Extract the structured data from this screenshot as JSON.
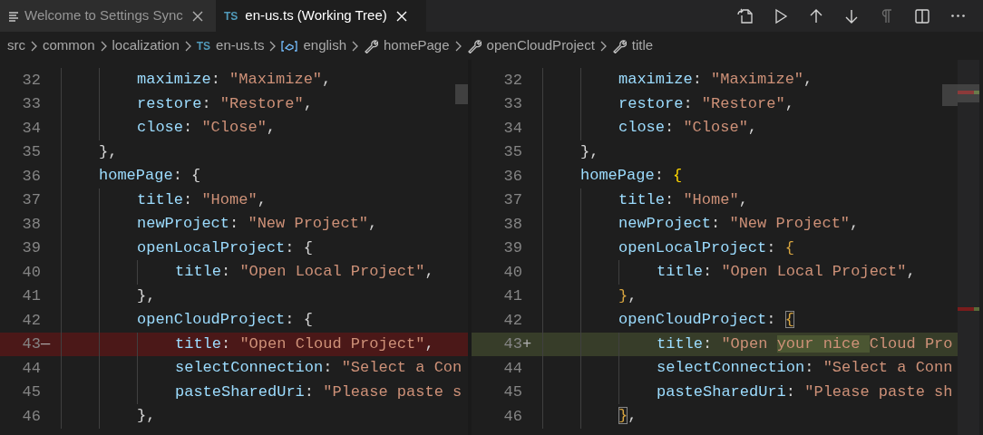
{
  "tabs": [
    {
      "label": "Welcome to Settings Sync",
      "kind": "document",
      "selected": false
    },
    {
      "label": "en-us.ts (Working Tree)",
      "kind": "typescript",
      "badge": "TS",
      "selected": true
    }
  ],
  "toolbar": [
    {
      "kind": "open-file",
      "disabled": false
    },
    {
      "kind": "run",
      "disabled": false
    },
    {
      "kind": "up",
      "disabled": false
    },
    {
      "kind": "down",
      "disabled": false
    },
    {
      "kind": "pilcrow",
      "disabled": true
    },
    {
      "kind": "split",
      "disabled": false
    },
    {
      "kind": "more",
      "disabled": false
    }
  ],
  "breadcrumb": [
    {
      "label": "src",
      "kind": "folder"
    },
    {
      "label": "common",
      "kind": "folder"
    },
    {
      "label": "localization",
      "kind": "folder"
    },
    {
      "label": "en-us.ts",
      "kind": "file",
      "badge": "TS"
    },
    {
      "label": "english",
      "kind": "variable"
    },
    {
      "label": "homePage",
      "kind": "property"
    },
    {
      "label": "openCloudProject",
      "kind": "property"
    },
    {
      "label": "title",
      "kind": "property"
    }
  ],
  "panes": [
    {
      "lines": [
        {
          "number": "32",
          "kind": "context",
          "tokens": [
            {
              "kind": "key",
              "text": "        maximize"
            },
            {
              "kind": "punct",
              "text": ": "
            },
            {
              "kind": "string",
              "text": "\"Maximize\""
            },
            {
              "kind": "punct",
              "text": ","
            }
          ]
        },
        {
          "number": "33",
          "kind": "context",
          "tokens": [
            {
              "kind": "key",
              "text": "        restore"
            },
            {
              "kind": "punct",
              "text": ": "
            },
            {
              "kind": "string",
              "text": "\"Restore\""
            },
            {
              "kind": "punct",
              "text": ","
            }
          ]
        },
        {
          "number": "34",
          "kind": "context",
          "tokens": [
            {
              "kind": "key",
              "text": "        close"
            },
            {
              "kind": "punct",
              "text": ": "
            },
            {
              "kind": "string",
              "text": "\"Close\""
            },
            {
              "kind": "punct",
              "text": ","
            }
          ]
        },
        {
          "number": "35",
          "kind": "context",
          "tokens": [
            {
              "kind": "punct",
              "text": "    },"
            }
          ]
        },
        {
          "number": "36",
          "kind": "context",
          "tokens": [
            {
              "kind": "key",
              "text": "    homePage"
            },
            {
              "kind": "punct",
              "text": ": {"
            }
          ]
        },
        {
          "number": "37",
          "kind": "context",
          "tokens": [
            {
              "kind": "key",
              "text": "        title"
            },
            {
              "kind": "punct",
              "text": ": "
            },
            {
              "kind": "string",
              "text": "\"Home\""
            },
            {
              "kind": "punct",
              "text": ","
            }
          ]
        },
        {
          "number": "38",
          "kind": "context",
          "tokens": [
            {
              "kind": "key",
              "text": "        newProject"
            },
            {
              "kind": "punct",
              "text": ": "
            },
            {
              "kind": "string",
              "text": "\"New Project\""
            },
            {
              "kind": "punct",
              "text": ","
            }
          ]
        },
        {
          "number": "39",
          "kind": "context",
          "tokens": [
            {
              "kind": "key",
              "text": "        openLocalProject"
            },
            {
              "kind": "punct",
              "text": ": {"
            }
          ]
        },
        {
          "number": "40",
          "kind": "context",
          "tokens": [
            {
              "kind": "key",
              "text": "            title"
            },
            {
              "kind": "punct",
              "text": ": "
            },
            {
              "kind": "string",
              "text": "\"Open Local Project\""
            },
            {
              "kind": "punct",
              "text": ","
            }
          ]
        },
        {
          "number": "41",
          "kind": "context",
          "tokens": [
            {
              "kind": "punct",
              "text": "        },"
            }
          ]
        },
        {
          "number": "42",
          "kind": "context",
          "tokens": [
            {
              "kind": "key",
              "text": "        openCloudProject"
            },
            {
              "kind": "punct",
              "text": ": {"
            }
          ]
        },
        {
          "number": "43",
          "marker": "—",
          "kind": "removed",
          "tokens": [
            {
              "kind": "key",
              "text": "            title"
            },
            {
              "kind": "punct",
              "text": ": "
            },
            {
              "kind": "string",
              "text": "\"Open Cloud Project\""
            },
            {
              "kind": "punct",
              "text": ","
            }
          ]
        },
        {
          "number": "44",
          "kind": "context",
          "tokens": [
            {
              "kind": "key",
              "text": "            selectConnection"
            },
            {
              "kind": "punct",
              "text": ": "
            },
            {
              "kind": "string",
              "text": "\"Select a Con"
            }
          ]
        },
        {
          "number": "45",
          "kind": "context",
          "tokens": [
            {
              "kind": "key",
              "text": "            pasteSharedUri"
            },
            {
              "kind": "punct",
              "text": ": "
            },
            {
              "kind": "string",
              "text": "\"Please paste s"
            }
          ]
        },
        {
          "number": "46",
          "kind": "context",
          "tokens": [
            {
              "kind": "punct",
              "text": "        },"
            }
          ]
        }
      ]
    },
    {
      "lines": [
        {
          "number": "32",
          "kind": "context",
          "tokens": [
            {
              "kind": "key",
              "text": "        maximize"
            },
            {
              "kind": "punct",
              "text": ": "
            },
            {
              "kind": "string",
              "text": "\"Maximize\""
            },
            {
              "kind": "punct",
              "text": ","
            }
          ]
        },
        {
          "number": "33",
          "kind": "context",
          "tokens": [
            {
              "kind": "key",
              "text": "        restore"
            },
            {
              "kind": "punct",
              "text": ": "
            },
            {
              "kind": "string",
              "text": "\"Restore\""
            },
            {
              "kind": "punct",
              "text": ","
            }
          ]
        },
        {
          "number": "34",
          "kind": "context",
          "tokens": [
            {
              "kind": "key",
              "text": "        close"
            },
            {
              "kind": "punct",
              "text": ": "
            },
            {
              "kind": "string",
              "text": "\"Close\""
            },
            {
              "kind": "punct",
              "text": ","
            }
          ]
        },
        {
          "number": "35",
          "kind": "context",
          "tokens": [
            {
              "kind": "punct",
              "text": "    },"
            }
          ]
        },
        {
          "number": "36",
          "kind": "context",
          "tokens": [
            {
              "kind": "key",
              "text": "    homePage"
            },
            {
              "kind": "punct",
              "text": ": "
            },
            {
              "kind": "bracket",
              "text": "{"
            }
          ]
        },
        {
          "number": "37",
          "kind": "context",
          "tokens": [
            {
              "kind": "key",
              "text": "        title"
            },
            {
              "kind": "punct",
              "text": ": "
            },
            {
              "kind": "string",
              "text": "\"Home\""
            },
            {
              "kind": "punct",
              "text": ","
            }
          ]
        },
        {
          "number": "38",
          "kind": "context",
          "tokens": [
            {
              "kind": "key",
              "text": "        newProject"
            },
            {
              "kind": "punct",
              "text": ": "
            },
            {
              "kind": "string",
              "text": "\"New Project\""
            },
            {
              "kind": "punct",
              "text": ","
            }
          ]
        },
        {
          "number": "39",
          "kind": "context",
          "tokens": [
            {
              "kind": "key",
              "text": "        openLocalProject"
            },
            {
              "kind": "punct",
              "text": ": "
            },
            {
              "kind": "bracket2",
              "text": "{"
            }
          ]
        },
        {
          "number": "40",
          "kind": "context",
          "tokens": [
            {
              "kind": "key",
              "text": "            title"
            },
            {
              "kind": "punct",
              "text": ": "
            },
            {
              "kind": "string",
              "text": "\"Open Local Project\""
            },
            {
              "kind": "punct",
              "text": ","
            }
          ]
        },
        {
          "number": "41",
          "kind": "context",
          "tokens": [
            {
              "kind": "bracket2",
              "text": "        }"
            },
            {
              "kind": "punct",
              "text": ","
            }
          ]
        },
        {
          "number": "42",
          "kind": "context",
          "tokens": [
            {
              "kind": "key",
              "text": "        openCloudProject"
            },
            {
              "kind": "punct",
              "text": ": "
            },
            {
              "kind": "bracket-match",
              "text": "{"
            }
          ]
        },
        {
          "number": "43",
          "marker": "+",
          "kind": "added",
          "tokens": [
            {
              "kind": "key",
              "text": "            title"
            },
            {
              "kind": "punct",
              "text": ": "
            },
            {
              "kind": "string",
              "text": "\"Open "
            },
            {
              "kind": "inserted",
              "text": "your nice "
            },
            {
              "kind": "string",
              "text": "Cloud Pro"
            }
          ]
        },
        {
          "number": "44",
          "kind": "context",
          "tokens": [
            {
              "kind": "key",
              "text": "            selectConnection"
            },
            {
              "kind": "punct",
              "text": ": "
            },
            {
              "kind": "string",
              "text": "\"Select a Conn"
            }
          ]
        },
        {
          "number": "45",
          "kind": "context",
          "tokens": [
            {
              "kind": "key",
              "text": "            pasteSharedUri"
            },
            {
              "kind": "punct",
              "text": ": "
            },
            {
              "kind": "string",
              "text": "\"Please paste sh"
            }
          ]
        },
        {
          "number": "46",
          "kind": "context",
          "tokens": [
            {
              "kind": "bracket-match",
              "text": "        }"
            },
            {
              "kind": "punct",
              "text": ","
            }
          ]
        }
      ]
    }
  ]
}
